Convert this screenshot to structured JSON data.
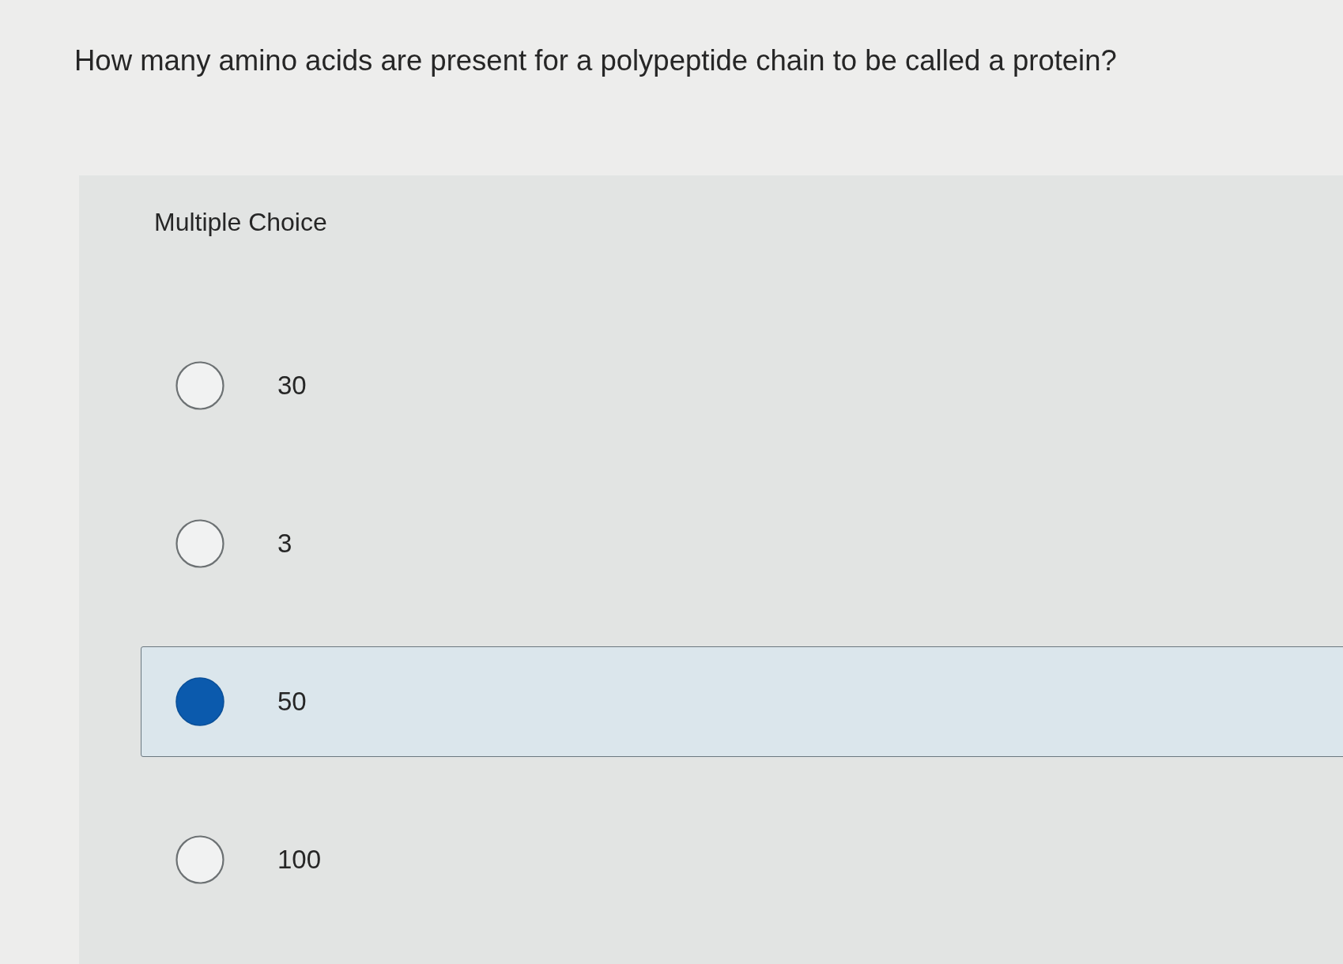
{
  "question": "How many amino acids are present for a polypeptide chain to be called a protein?",
  "panel": {
    "label": "Multiple Choice",
    "options": [
      {
        "label": "30",
        "selected": false
      },
      {
        "label": "3",
        "selected": false
      },
      {
        "label": "50",
        "selected": true
      },
      {
        "label": "100",
        "selected": false
      }
    ]
  }
}
